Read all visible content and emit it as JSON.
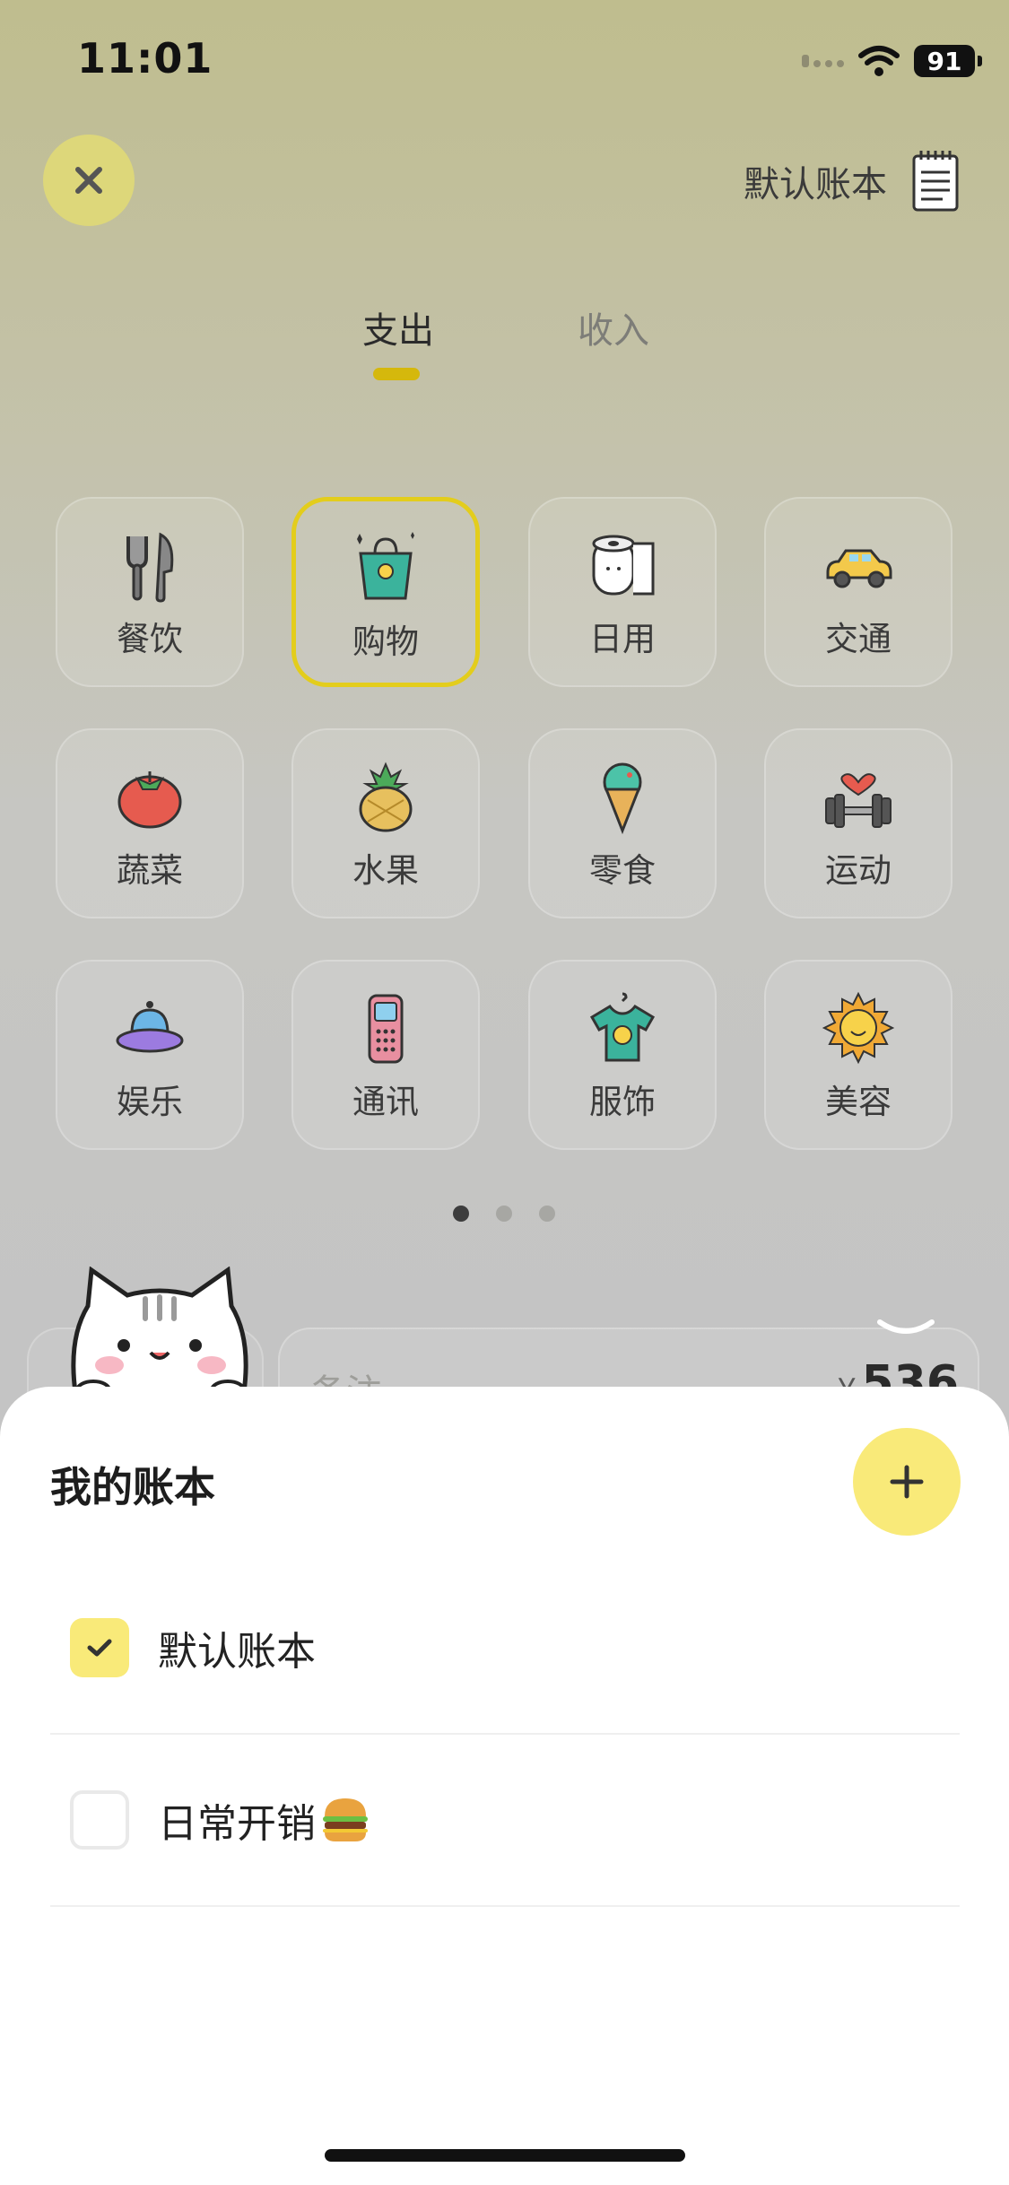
{
  "status_bar": {
    "time": "11:01",
    "battery": "91"
  },
  "header": {
    "book_name": "默认账本"
  },
  "tabs": [
    {
      "label": "支出",
      "active": true
    },
    {
      "label": "收入",
      "active": false
    }
  ],
  "categories": [
    {
      "label": "餐饮",
      "icon": "fork-knife-icon",
      "selected": false
    },
    {
      "label": "购物",
      "icon": "shopping-bag-icon",
      "selected": true
    },
    {
      "label": "日用",
      "icon": "toilet-paper-icon",
      "selected": false
    },
    {
      "label": "交通",
      "icon": "car-icon",
      "selected": false
    },
    {
      "label": "蔬菜",
      "icon": "tomato-icon",
      "selected": false
    },
    {
      "label": "水果",
      "icon": "pineapple-icon",
      "selected": false
    },
    {
      "label": "零食",
      "icon": "ice-cream-icon",
      "selected": false
    },
    {
      "label": "运动",
      "icon": "dumbbell-icon",
      "selected": false
    },
    {
      "label": "娱乐",
      "icon": "ufo-icon",
      "selected": false
    },
    {
      "label": "通讯",
      "icon": "phone-icon",
      "selected": false
    },
    {
      "label": "服饰",
      "icon": "tshirt-icon",
      "selected": false
    },
    {
      "label": "美容",
      "icon": "sun-icon",
      "selected": false
    }
  ],
  "pager": {
    "pages": 3,
    "current": 1
  },
  "note": {
    "placeholder": "备注",
    "currency": "¥",
    "amount": "536"
  },
  "sheet": {
    "title": "我的账本",
    "books": [
      {
        "label": "默认账本",
        "checked": true
      },
      {
        "label": "日常开销",
        "checked": false,
        "emoji": "burger-icon"
      }
    ]
  },
  "colors": {
    "accent": "#f9ea79",
    "selected_border": "#e3cd1c",
    "tab_indicator": "#d5b80c"
  }
}
